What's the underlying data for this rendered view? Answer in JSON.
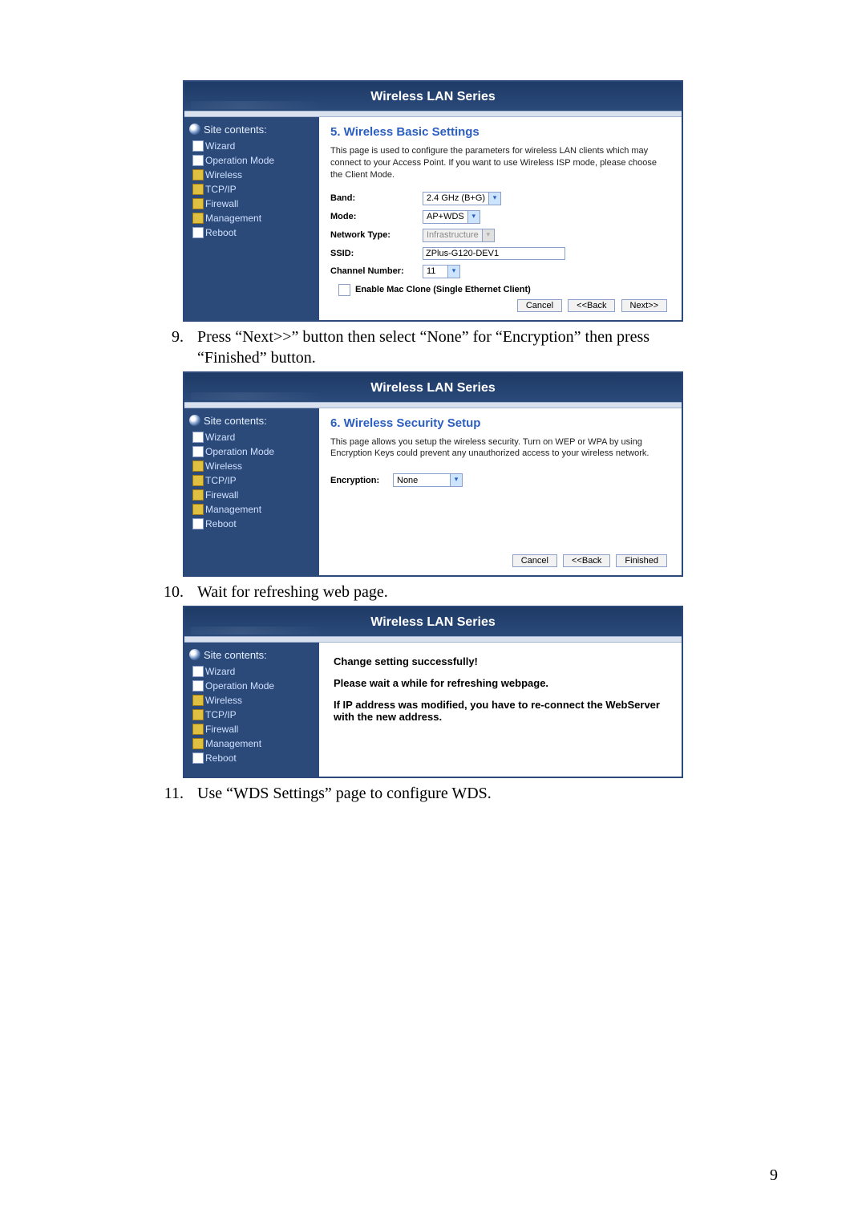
{
  "header_title": "Wireless LAN Series",
  "sidebar": {
    "title": "Site contents:",
    "items": [
      {
        "label": "Wizard",
        "icon": "page"
      },
      {
        "label": "Operation Mode",
        "icon": "page"
      },
      {
        "label": "Wireless",
        "icon": "folder"
      },
      {
        "label": "TCP/IP",
        "icon": "folder"
      },
      {
        "label": "Firewall",
        "icon": "folder"
      },
      {
        "label": "Management",
        "icon": "folder"
      },
      {
        "label": "Reboot",
        "icon": "page"
      }
    ]
  },
  "panel1": {
    "title": "5. Wireless Basic Settings",
    "desc": "This page is used to configure the parameters for wireless LAN clients which may connect to your Access Point. If you want to use Wireless ISP mode, please choose the Client Mode.",
    "fields": {
      "band_label": "Band:",
      "band_value": "2.4 GHz (B+G)",
      "mode_label": "Mode:",
      "mode_value": "AP+WDS",
      "nettype_label": "Network Type:",
      "nettype_value": "Infrastructure",
      "ssid_label": "SSID:",
      "ssid_value": "ZPlus-G120-DEV1",
      "channel_label": "Channel Number:",
      "channel_value": "11",
      "mac_clone_label": "Enable Mac Clone (Single Ethernet Client)"
    },
    "buttons": {
      "cancel": "Cancel",
      "back": "<<Back",
      "next": "Next>>"
    }
  },
  "step9": {
    "num": "9.",
    "text": "Press “Next>>” button then select “None” for “Encryption” then press “Finished” button."
  },
  "panel2": {
    "title": "6. Wireless Security Setup",
    "desc": "This page allows you setup the wireless security. Turn on WEP or WPA by using Encryption Keys could prevent any unauthorized access to your wireless network.",
    "enc_label": "Encryption:",
    "enc_value": "None",
    "buttons": {
      "cancel": "Cancel",
      "back": "<<Back",
      "finished": "Finished"
    }
  },
  "step10": {
    "num": "10.",
    "text": "Wait for refreshing web page."
  },
  "panel3": {
    "line1": "Change setting successfully!",
    "line2": "Please wait a while for refreshing webpage.",
    "line3": "If IP address was modified, you have to re-connect the WebServer with the new address."
  },
  "step11": {
    "num": "11.",
    "text": "Use “WDS Settings” page to configure WDS."
  },
  "page_number": "9"
}
